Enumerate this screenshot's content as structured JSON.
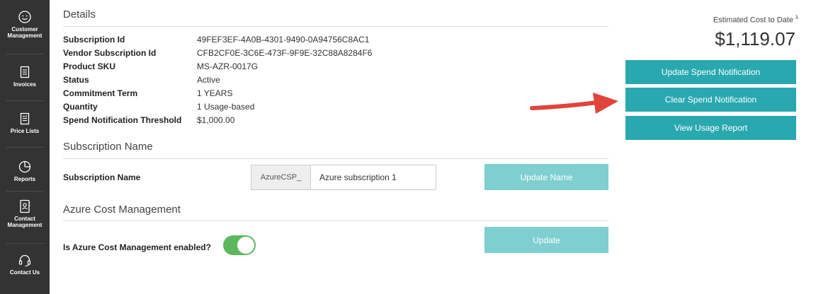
{
  "sidebar": {
    "items": [
      {
        "label": "Customer\nManagement",
        "icon": "user-circle-icon"
      },
      {
        "label": "Invoices",
        "icon": "document-icon"
      },
      {
        "label": "Price Lists",
        "icon": "price-list-icon"
      },
      {
        "label": "Reports",
        "icon": "clock-chart-icon"
      },
      {
        "label": "Contact\nManagement",
        "icon": "contact-book-icon"
      },
      {
        "label": "Contact Us",
        "icon": "headset-icon"
      }
    ]
  },
  "details": {
    "title": "Details",
    "rows": [
      {
        "label": "Subscription Id",
        "value": "49FEF3EF-4A0B-4301-9490-0A94756C8AC1"
      },
      {
        "label": "Vendor Subscription Id",
        "value": "CFB2CF0E-3C6E-473F-9F9E-32C88A8284F6"
      },
      {
        "label": "Product SKU",
        "value": "MS-AZR-0017G"
      },
      {
        "label": "Status",
        "value": "Active"
      },
      {
        "label": "Commitment Term",
        "value": "1 YEARS"
      },
      {
        "label": "Quantity",
        "value": "1 Usage-based"
      },
      {
        "label": "Spend Notification Threshold",
        "value": "$1,000.00"
      }
    ]
  },
  "subscription_name": {
    "title": "Subscription Name",
    "label": "Subscription Name",
    "prefix": "AzureCSP_",
    "value": "Azure subscription 1",
    "button": "Update Name"
  },
  "cost_management": {
    "title": "Azure Cost Management",
    "label": "Is Azure Cost Management enabled?",
    "enabled": true,
    "button": "Update"
  },
  "cost": {
    "label": "Estimated Cost to Date",
    "marker": "λ",
    "value": "$1,119.07"
  },
  "actions": {
    "update_spend": "Update Spend Notification",
    "clear_spend": "Clear Spend Notification",
    "view_usage": "View Usage Report"
  },
  "colors": {
    "sidebar": "#333333",
    "primary": "#2aa8b0",
    "disabled": "#7fcfd0",
    "toggle_on": "#5cb85c",
    "arrow": "#e0443a"
  }
}
